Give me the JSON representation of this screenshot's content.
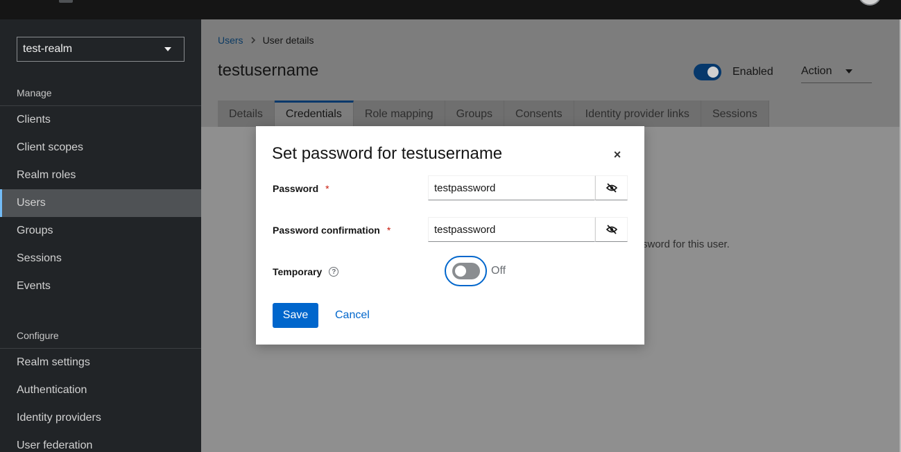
{
  "sidebar": {
    "realm": "test-realm",
    "manage_heading": "Manage",
    "manage_items": [
      "Clients",
      "Client scopes",
      "Realm roles",
      "Users",
      "Groups",
      "Sessions",
      "Events"
    ],
    "configure_heading": "Configure",
    "configure_items": [
      "Realm settings",
      "Authentication",
      "Identity providers",
      "User federation"
    ]
  },
  "breadcrumb": {
    "parent": "Users",
    "current": "User details"
  },
  "header": {
    "title": "testusername",
    "enabled_label": "Enabled",
    "action_label": "Action"
  },
  "tabs": [
    "Details",
    "Credentials",
    "Role mapping",
    "Groups",
    "Consents",
    "Identity provider links",
    "Sessions"
  ],
  "background_text": "sword for this user.",
  "modal": {
    "title": "Set password for testusername",
    "password_label": "Password",
    "password_value": "testpassword",
    "confirm_label": "Password confirmation",
    "confirm_value": "testpassword",
    "required_mark": "*",
    "temporary_label": "Temporary",
    "help_glyph": "?",
    "temporary_state": "Off",
    "save_label": "Save",
    "cancel_label": "Cancel",
    "close_glyph": "×"
  },
  "colors": {
    "primary": "#0066cc",
    "required": "#c9190b",
    "sidebar_bg": "#212427"
  },
  "icons": [
    "chevron-right-icon",
    "caret-down-icon",
    "eye-slash-icon",
    "help-icon",
    "close-icon"
  ]
}
